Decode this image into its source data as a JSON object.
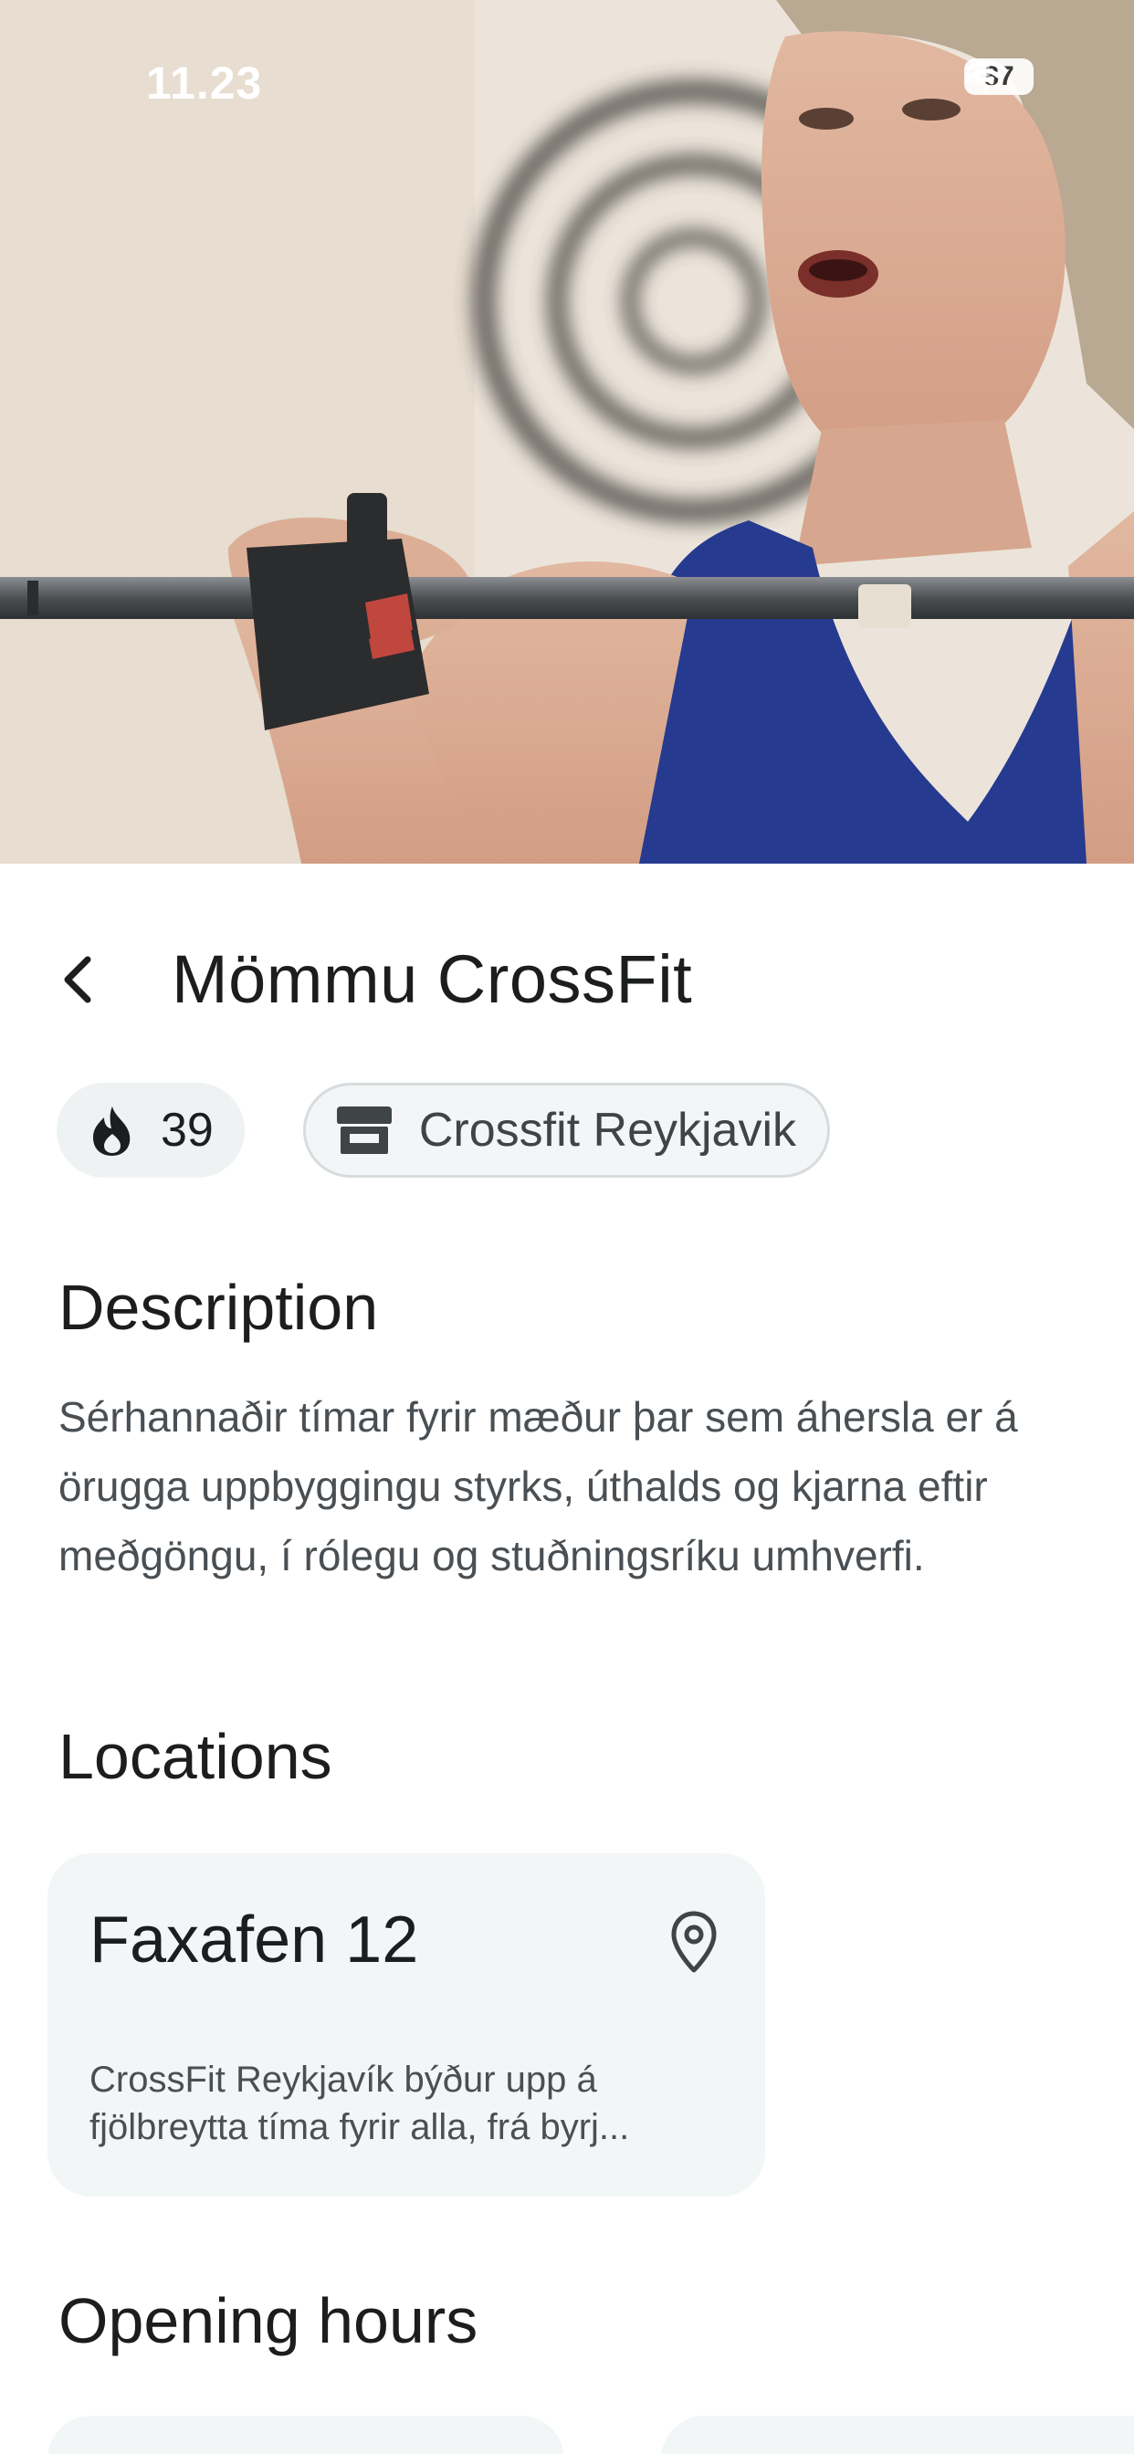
{
  "status_bar": {
    "time": "11.23",
    "battery": "87"
  },
  "hero": {
    "image": "woman lifting barbell"
  },
  "header": {
    "title": "Mömmu CrossFit",
    "back_icon": "chevron-left-icon"
  },
  "chips": {
    "streak": {
      "icon": "fire-icon",
      "value": "39"
    },
    "gym": {
      "icon": "storefront-icon",
      "label": "Crossfit Reykjavik"
    }
  },
  "description": {
    "heading": "Description",
    "text": "Sérhannaðir tímar fyrir mæður þar sem áhersla er á örugga uppbyggingu styrks, úthalds og kjarna eftir meðgöngu, í rólegu og stuðningsríku umhverfi."
  },
  "locations": {
    "heading": "Locations",
    "items": [
      {
        "name": "Faxafen 12",
        "icon": "map-pin-icon",
        "blurb": "CrossFit Reykjavík býður upp á\nfjölbreytta tíma fyrir alla, frá byrj..."
      }
    ]
  },
  "opening_hours": {
    "heading": "Opening hours"
  },
  "colors": {
    "accent": "#1b1d1e",
    "chip_bg": "#eef2f3",
    "card_bg": "#f3f6f7"
  }
}
